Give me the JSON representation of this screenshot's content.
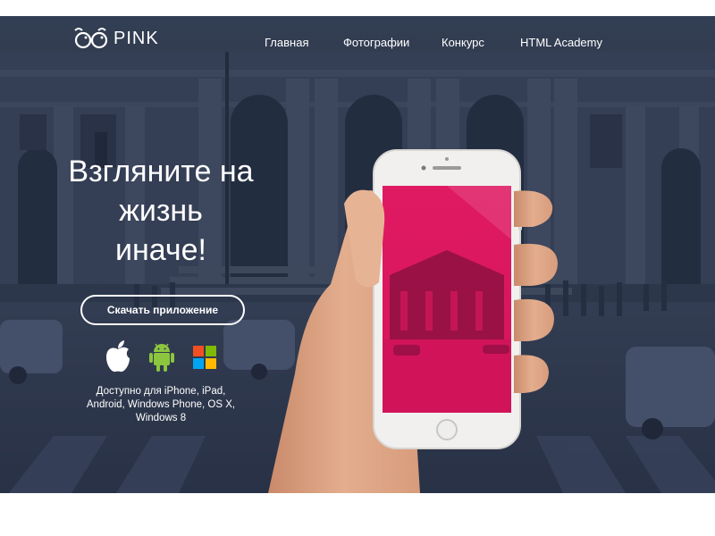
{
  "header": {
    "logo_text": "PINK",
    "nav": [
      {
        "label": "Главная"
      },
      {
        "label": "Фотографии"
      },
      {
        "label": "Конкурс"
      },
      {
        "label": "HTML Academy"
      }
    ]
  },
  "hero": {
    "headline_lines": [
      "Взгляните на",
      "жизнь",
      "иначе!"
    ],
    "download_button": "Скачать приложение",
    "platform_icons": [
      "apple-icon",
      "android-icon",
      "windows-icon"
    ],
    "availability_lines": [
      "Доступно для iPhone, iPad,",
      "Android, Windows Phone, OS X,",
      "Windows 8"
    ]
  },
  "colors": {
    "accent_pink": "#e0185f",
    "hero_overlay": "#26304a",
    "android_green": "#8cc63f",
    "windows_red": "#f25022",
    "windows_green": "#7fba00",
    "windows_blue": "#00a4ef",
    "windows_yellow": "#ffb900"
  }
}
